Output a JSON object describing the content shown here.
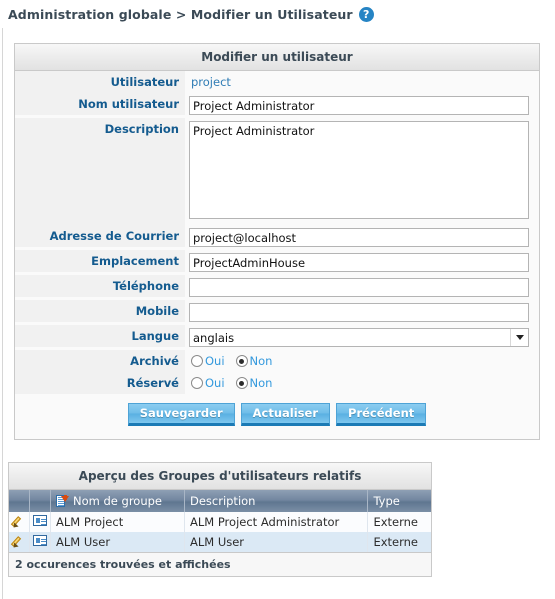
{
  "breadcrumb": {
    "text": "Administration globale > Modifier un Utilisateur",
    "help_icon": "help-circle-icon",
    "help_glyph": "?"
  },
  "form": {
    "title": "Modifier un utilisateur",
    "fields": {
      "username_label": "Utilisateur",
      "username_value": "project",
      "fullname_label": "Nom utilisateur",
      "fullname_value": "Project Administrator",
      "description_label": "Description",
      "description_value": "Project Administrator",
      "email_label": "Adresse de Courrier",
      "email_value": "project@localhost",
      "location_label": "Emplacement",
      "location_value": "ProjectAdminHouse",
      "phone_label": "Téléphone",
      "phone_value": "",
      "mobile_label": "Mobile",
      "mobile_value": "",
      "language_label": "Langue",
      "language_value": "anglais",
      "archived_label": "Archivé",
      "reserved_label": "Réservé"
    },
    "radio_options": {
      "yes": "Oui",
      "no": "Non"
    },
    "archived_selected": "Non",
    "reserved_selected": "Non",
    "buttons": {
      "save": "Sauvegarder",
      "refresh": "Actualiser",
      "back": "Précédent"
    }
  },
  "groups": {
    "title": "Aperçu des Groupes d'utilisateurs relatifs",
    "columns": [
      "",
      "",
      "Nom de groupe",
      "Description",
      "Type"
    ],
    "sort_icon": "sort-descending-icon",
    "row_icons": {
      "edit": "pencil-icon",
      "details": "card-details-icon"
    },
    "rows": [
      {
        "name": "ALM Project",
        "description": "ALM Project Administrator",
        "type": "Externe"
      },
      {
        "name": "ALM User",
        "description": "ALM User",
        "type": "Externe"
      }
    ],
    "footer": "2 occurences trouvées et affichées"
  },
  "colors": {
    "label_text": "#145b8f",
    "link_text": "#2f7cb5",
    "radio_text": "#3399dd",
    "button_blue": "#6fbde9",
    "grid_header": "#6f86a0",
    "accent": "#2684c4"
  }
}
